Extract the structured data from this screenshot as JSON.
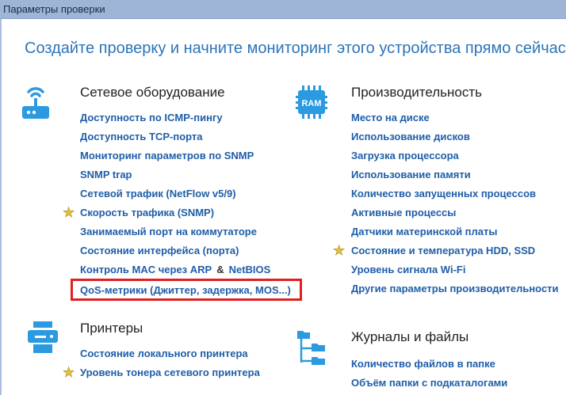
{
  "window": {
    "title": "Параметры проверки"
  },
  "headline": "Создайте проверку и начните мониторинг этого устройства прямо сейчас",
  "sections": {
    "network": {
      "title": "Сетевое оборудование",
      "icon": "router-icon",
      "links": [
        "Доступность по ICMP-пингу",
        "Доступность TCP-порта",
        "Мониторинг параметров по SNMP",
        "SNMP trap",
        "Сетевой трафик (NetFlow v5/9)",
        "Скорость трафика (SNMP)",
        "Занимаемый порт на коммутаторе",
        "Состояние интерфейса (порта)",
        "Контроль MAC через ARP",
        "QoS-метрики (Джиттер, задержка, MOS...)"
      ],
      "arp_sep": "&",
      "arp_netbios": "NetBIOS",
      "starred": [
        "Скорость трафика (SNMP)"
      ],
      "highlighted": "QoS-метрики (Джиттер, задержка, MOS...)"
    },
    "performance": {
      "title": "Производительность",
      "icon": "ram-chip-icon",
      "icon_text": "RAM",
      "links": [
        "Место на диске",
        "Использование дисков",
        "Загрузка процессора",
        "Использование памяти",
        "Количество запущенных процессов",
        "Активные процессы",
        "Датчики материнской платы",
        "Состояние и температура HDD, SSD",
        "Уровень сигнала Wi-Fi",
        "Другие параметры производительности"
      ],
      "starred": [
        "Состояние и температура HDD, SSD"
      ]
    },
    "printers": {
      "title": "Принтеры",
      "icon": "printer-icon",
      "links": [
        "Состояние локального принтера",
        "Уровень тонера сетевого принтера"
      ],
      "starred": [
        "Уровень тонера сетевого принтера"
      ]
    },
    "logs": {
      "title": "Журналы и файлы",
      "icon": "folder-tree-icon",
      "links": [
        "Количество файлов в папке",
        "Объём папки с подкаталогами"
      ],
      "starred": []
    }
  },
  "colors": {
    "accent": "#2c74b8",
    "link": "#1f5ea8",
    "icon": "#2b9ae0",
    "highlight": "#e02020",
    "star": "#e8c13a",
    "titlebar": "#9fb5d8"
  }
}
